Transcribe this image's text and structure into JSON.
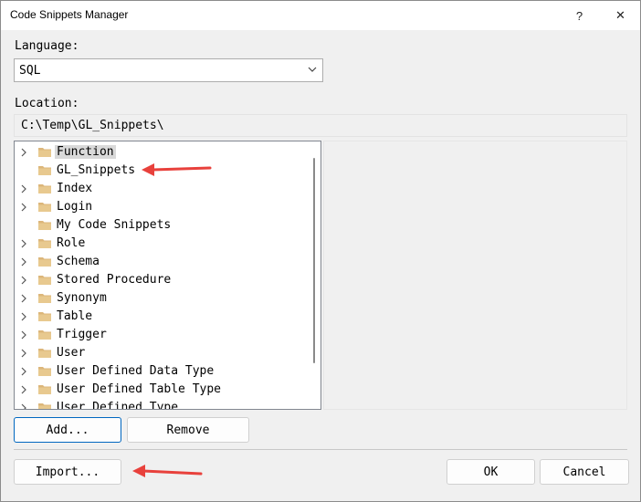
{
  "window": {
    "title": "Code Snippets Manager",
    "help_label": "?",
    "close_label": "✕"
  },
  "language": {
    "label": "Language:",
    "selected": "SQL"
  },
  "location": {
    "label": "Location:",
    "path": "C:\\Temp\\GL_Snippets\\"
  },
  "tree": {
    "items": [
      {
        "label": "Function",
        "expandable": true,
        "selected": true
      },
      {
        "label": "GL_Snippets",
        "expandable": false,
        "selected": false
      },
      {
        "label": "Index",
        "expandable": true,
        "selected": false
      },
      {
        "label": "Login",
        "expandable": true,
        "selected": false
      },
      {
        "label": "My Code Snippets",
        "expandable": false,
        "selected": false
      },
      {
        "label": "Role",
        "expandable": true,
        "selected": false
      },
      {
        "label": "Schema",
        "expandable": true,
        "selected": false
      },
      {
        "label": "Stored Procedure",
        "expandable": true,
        "selected": false
      },
      {
        "label": "Synonym",
        "expandable": true,
        "selected": false
      },
      {
        "label": "Table",
        "expandable": true,
        "selected": false
      },
      {
        "label": "Trigger",
        "expandable": true,
        "selected": false
      },
      {
        "label": "User",
        "expandable": true,
        "selected": false
      },
      {
        "label": "User Defined Data Type",
        "expandable": true,
        "selected": false
      },
      {
        "label": "User Defined Table Type",
        "expandable": true,
        "selected": false
      },
      {
        "label": "User Defined Type",
        "expandable": true,
        "selected": false
      }
    ]
  },
  "buttons": {
    "add": "Add...",
    "remove": "Remove",
    "import": "Import...",
    "ok": "OK",
    "cancel": "Cancel"
  },
  "colors": {
    "folder": "#dcb67a",
    "annotation_arrow": "#e8413c",
    "default_button_border": "#0067c0"
  },
  "icons": {
    "folder": "folder-icon",
    "expander": "chevron-right-icon",
    "dropdown": "chevron-down-icon"
  }
}
